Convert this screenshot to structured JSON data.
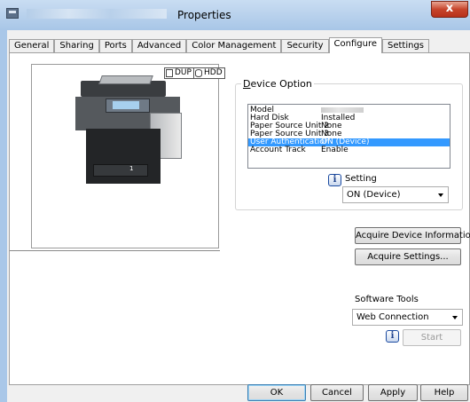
{
  "window": {
    "title": "Properties",
    "close_label": "x"
  },
  "tabs": [
    {
      "label": "General"
    },
    {
      "label": "Sharing"
    },
    {
      "label": "Ports"
    },
    {
      "label": "Advanced"
    },
    {
      "label": "Color Management"
    },
    {
      "label": "Security"
    },
    {
      "label": "Configure",
      "active": true
    },
    {
      "label": "Settings"
    }
  ],
  "preview": {
    "badge_dup": "DUP",
    "badge_hdd": "HDD",
    "printer_number": "1"
  },
  "device_option": {
    "title": "Device Option",
    "items": [
      {
        "key": "Model",
        "value": ""
      },
      {
        "key": "Hard Disk",
        "value": "Installed"
      },
      {
        "key": "Paper Source Unit 2",
        "value": "None"
      },
      {
        "key": "Paper Source Unit 3",
        "value": "None"
      },
      {
        "key": "User Authentication",
        "value": "ON (Device)",
        "selected": true
      },
      {
        "key": "Account Track",
        "value": "Enable"
      }
    ],
    "setting_label": "Setting",
    "setting_value": "ON (Device)"
  },
  "buttons": {
    "acquire_device_info": "Acquire Device Information",
    "acquire_settings": "Acquire Settings...",
    "start": "Start",
    "ok": "OK",
    "cancel": "Cancel",
    "apply": "Apply",
    "help": "Help"
  },
  "software_tools": {
    "label": "Software Tools",
    "value": "Web Connection"
  },
  "colors": {
    "selection": "#3399ff",
    "titlebar": "#a8c6e7",
    "close": "#c7452c"
  }
}
